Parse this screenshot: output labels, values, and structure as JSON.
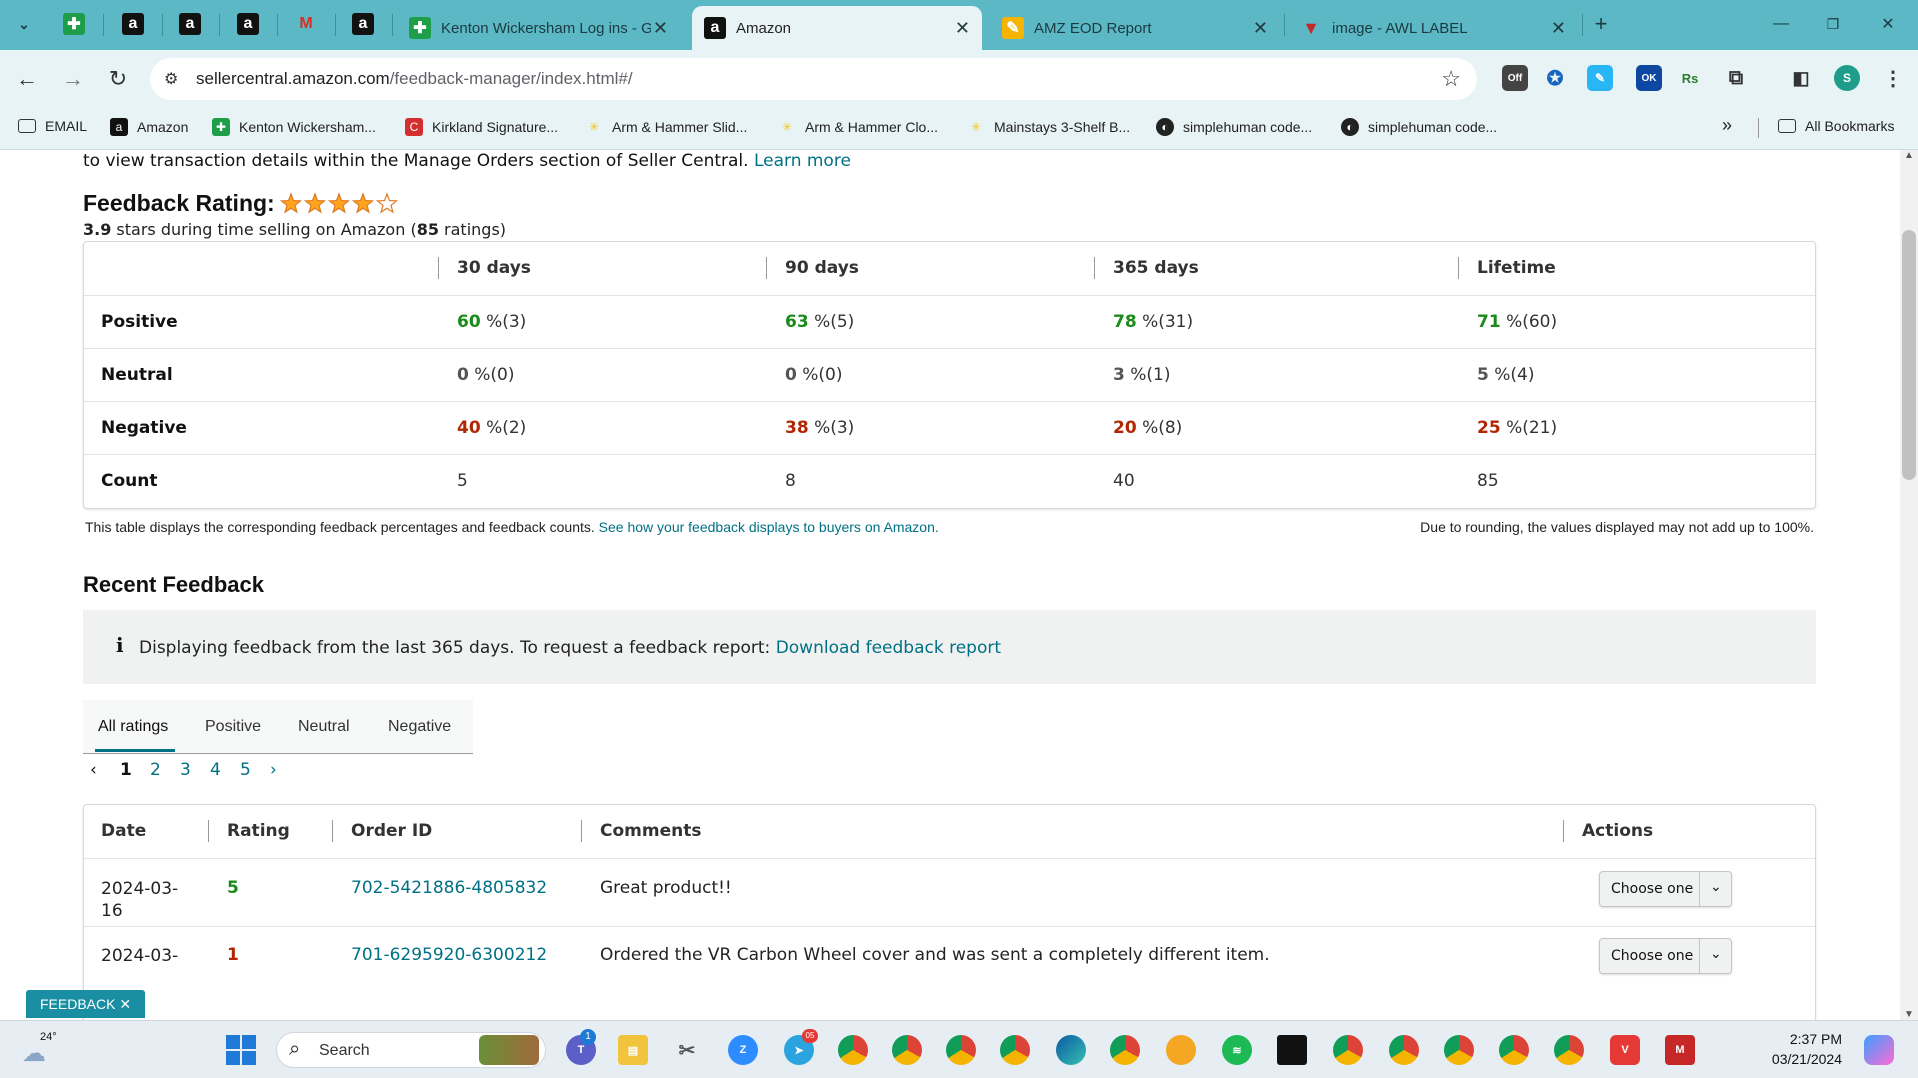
{
  "tabs": [
    {
      "title": "",
      "icon": "plus-icon"
    },
    {
      "title": "",
      "icon": "amazon-icon"
    },
    {
      "title": "",
      "icon": "amazon-icon"
    },
    {
      "title": "",
      "icon": "amazon-icon"
    },
    {
      "title": "",
      "icon": "gmail-icon"
    },
    {
      "title": "",
      "icon": "amazon-icon"
    },
    {
      "title": "Kenton Wickersham Log ins - G",
      "icon": "plus-icon"
    },
    {
      "title": "Amazon",
      "icon": "amazon-icon",
      "active": true
    },
    {
      "title": "AMZ EOD Report",
      "icon": "script-icon"
    },
    {
      "title": "image - AWL LABEL",
      "icon": "label-icon"
    }
  ],
  "browser": {
    "url_host": "sellercentral.amazon.com",
    "url_path": "/feedback-manager/index.html#/"
  },
  "extensions": {
    "off_badge": "Off",
    "ok_badge": "OK",
    "rs_label": "Rs",
    "profile_initial": "S"
  },
  "bookmarks": [
    "EMAIL",
    "Amazon",
    "Kenton Wickersham...",
    "Kirkland Signature...",
    "Arm & Hammer Slid...",
    "Arm & Hammer Clo...",
    "Mainstays 3-Shelf B...",
    "simplehuman code...",
    "simplehuman code..."
  ],
  "bookmarks_more": "»",
  "all_bookmarks": "All Bookmarks",
  "intro": {
    "text": "to view transaction details within the Manage Orders section of Seller Central.",
    "link": "Learn more"
  },
  "rating": {
    "title": "Feedback Rating:",
    "stars": 3.9,
    "stars_value": "3.9",
    "stars_text_mid": " stars during time selling on Amazon (",
    "count": "85",
    "stars_text_end": " ratings)"
  },
  "feedback_table": {
    "headers": [
      "",
      "30 days",
      "90 days",
      "365 days",
      "Lifetime"
    ],
    "rows": [
      {
        "label": "Positive",
        "cls": "green",
        "cells": [
          {
            "v": "60",
            "s": " %(3)"
          },
          {
            "v": "63",
            "s": " %(5)"
          },
          {
            "v": "78",
            "s": " %(31)"
          },
          {
            "v": "71",
            "s": " %(60)"
          }
        ]
      },
      {
        "label": "Neutral",
        "cls": "gray",
        "cells": [
          {
            "v": "0",
            "s": " %(0)"
          },
          {
            "v": "0",
            "s": " %(0)"
          },
          {
            "v": "3",
            "s": " %(1)"
          },
          {
            "v": "5",
            "s": " %(4)"
          }
        ]
      },
      {
        "label": "Negative",
        "cls": "red",
        "cells": [
          {
            "v": "40",
            "s": " %(2)"
          },
          {
            "v": "38",
            "s": " %(3)"
          },
          {
            "v": "20",
            "s": " %(8)"
          },
          {
            "v": "25",
            "s": " %(21)"
          }
        ]
      },
      {
        "label": "Count",
        "cls": "",
        "cells": [
          {
            "v": "",
            "s": "5"
          },
          {
            "v": "",
            "s": "8"
          },
          {
            "v": "",
            "s": "40"
          },
          {
            "v": "",
            "s": "85"
          }
        ]
      }
    ],
    "footnote": "This table displays the corresponding feedback percentages and feedback counts.",
    "footnote_link": "See how your feedback displays to buyers on Amazon.",
    "rounding_note": "Due to rounding, the values displayed may not add up to 100%."
  },
  "recent": {
    "title": "Recent Feedback",
    "info": "Displaying feedback from the last 365 days. To request a feedback report:",
    "info_link": "Download feedback report",
    "tabs": [
      "All ratings",
      "Positive",
      "Neutral",
      "Negative"
    ],
    "pages": [
      "1",
      "2",
      "3",
      "4",
      "5"
    ],
    "columns": [
      "Date",
      "Rating",
      "Order ID",
      "Comments",
      "Actions"
    ],
    "rows": [
      {
        "date": "2024-03-\n16",
        "rating": "5",
        "rating_cls": "green",
        "order": "702-5421886-4805832",
        "comment": "Great product!!",
        "action": "Choose one"
      },
      {
        "date": "2024-03-",
        "rating": "1",
        "rating_cls": "red",
        "order": "701-6295920-6300212",
        "comment": "Ordered the VR Carbon Wheel cover and was sent a completely different item.",
        "action": "Choose one"
      }
    ]
  },
  "feedback_button": "FEEDBACK",
  "taskbar": {
    "weather": "24°",
    "search": "Search",
    "time": "2:37 PM",
    "date": "03/21/2024",
    "teams_badge": "1",
    "telegram_badge": "05"
  }
}
